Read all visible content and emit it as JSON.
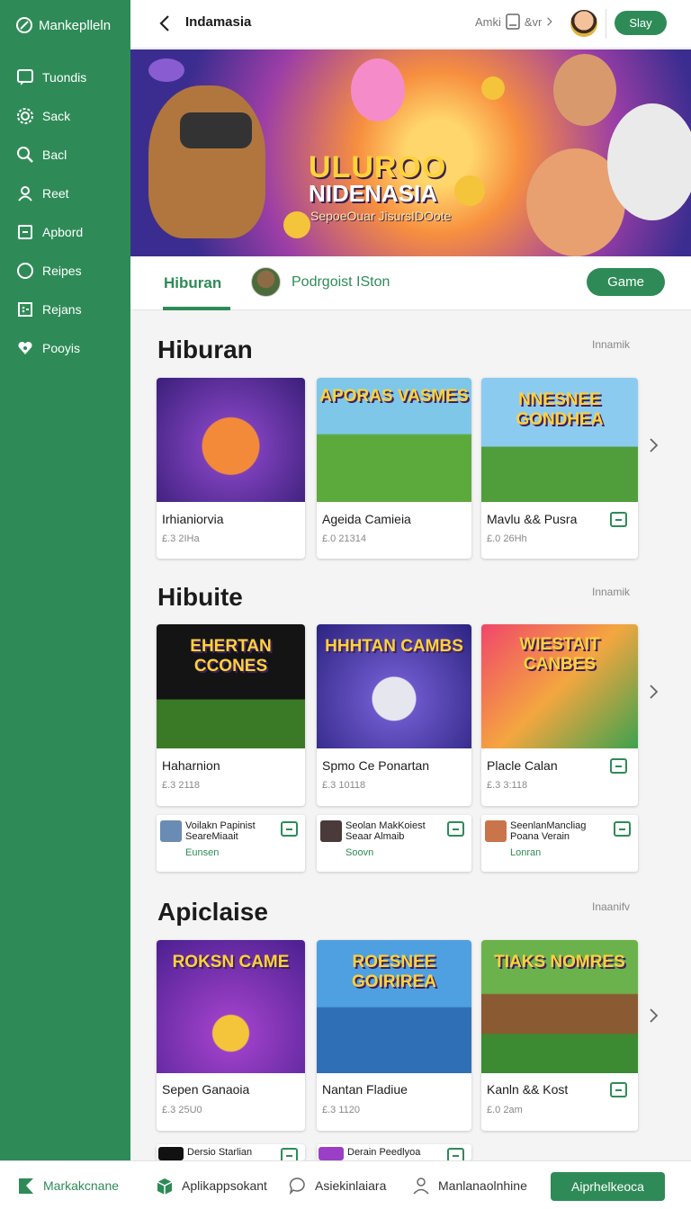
{
  "sidebar": {
    "brand": "Mankeplleln",
    "items": [
      {
        "label": "Tuondis",
        "icon": "chat-icon"
      },
      {
        "label": "Sack",
        "icon": "gear-icon"
      },
      {
        "label": "Bacl",
        "icon": "search-icon"
      },
      {
        "label": "Reet",
        "icon": "user-icon"
      },
      {
        "label": "Apbord",
        "icon": "square-icon"
      },
      {
        "label": "Reipes",
        "icon": "circle-icon"
      },
      {
        "label": "Rejans",
        "icon": "grid-icon"
      },
      {
        "label": "Pooyis",
        "icon": "heart-icon"
      }
    ]
  },
  "topbar": {
    "title": "Indamasia",
    "right_text": "Amki",
    "right_text2": "&vr",
    "button": "Slay"
  },
  "banner": {
    "title_line1": "ULUROO",
    "title_line2": "NIDENASIA",
    "subtitle": "SepoeOuar JisursIDOote"
  },
  "tabs": {
    "active": "Hiburan",
    "second": "Podrgoist ISton",
    "button": "Game"
  },
  "sections": [
    {
      "title": "Hiburan",
      "more": "Innamik",
      "cards": [
        {
          "name": "Irhianiorvia",
          "meta": "£.3 2IHa",
          "thumb_text": ""
        },
        {
          "name": "Ageida Camieia",
          "meta": "£.0 21314",
          "thumb_text": "APORAS VASMES"
        },
        {
          "name": "Mavlu && Pusra",
          "meta": "£.0 26Hh",
          "thumb_text": "NNESNEE GONDHEA"
        }
      ]
    },
    {
      "title": "Hibuite",
      "more": "Innamik",
      "cards": [
        {
          "name": "Haharnion",
          "meta": "£.3 2118",
          "thumb_text": "EHERTAN CCONES"
        },
        {
          "name": "Spmo Ce Ponartan",
          "meta": "£.3 10118",
          "thumb_text": "HHHTAN CAMBS"
        },
        {
          "name": "Placle Calan",
          "meta": "£.3 3:118",
          "thumb_text": "WIESTAIT CANBES"
        }
      ],
      "minis": [
        {
          "line1": "Voilakn Papinist SeareMiaait",
          "line2": "Eunsen"
        },
        {
          "line1": "Seolan MakKoiest Seaar Almaib",
          "line2": "Soovn"
        },
        {
          "line1": "SeenlanMancliag Poana Verain",
          "line2": "Lonran"
        }
      ]
    },
    {
      "title": "Apiclaise",
      "more": "Inaanifv",
      "cards": [
        {
          "name": "Sepen Ganaoia",
          "meta": "£.3 25U0",
          "thumb_text": "ROKSN CAME"
        },
        {
          "name": "Nantan Fladiue",
          "meta": "£.3 1120",
          "thumb_text": "ROESNEE GOIRIREA"
        },
        {
          "name": "Kanln && Kost",
          "meta": "£.0 2am",
          "thumb_text": "TIAKS NOMRES"
        }
      ],
      "peek": [
        {
          "line1": "Dersio Starlian"
        },
        {
          "line1": "Derain Peedlyoa"
        }
      ]
    }
  ],
  "bottombar": {
    "items": [
      {
        "label": "Markakcnane",
        "icon": "map-icon"
      },
      {
        "label": "Aplikappsokant",
        "icon": "box-icon"
      },
      {
        "label": "Asiekinlaiara",
        "icon": "chat-bubble-icon"
      },
      {
        "label": "Manlanaolnhine",
        "icon": "person-icon"
      }
    ],
    "button": "Aiprhelkeoca"
  },
  "colors": {
    "accent": "#2e8b57",
    "background": "#f3f4f3"
  }
}
